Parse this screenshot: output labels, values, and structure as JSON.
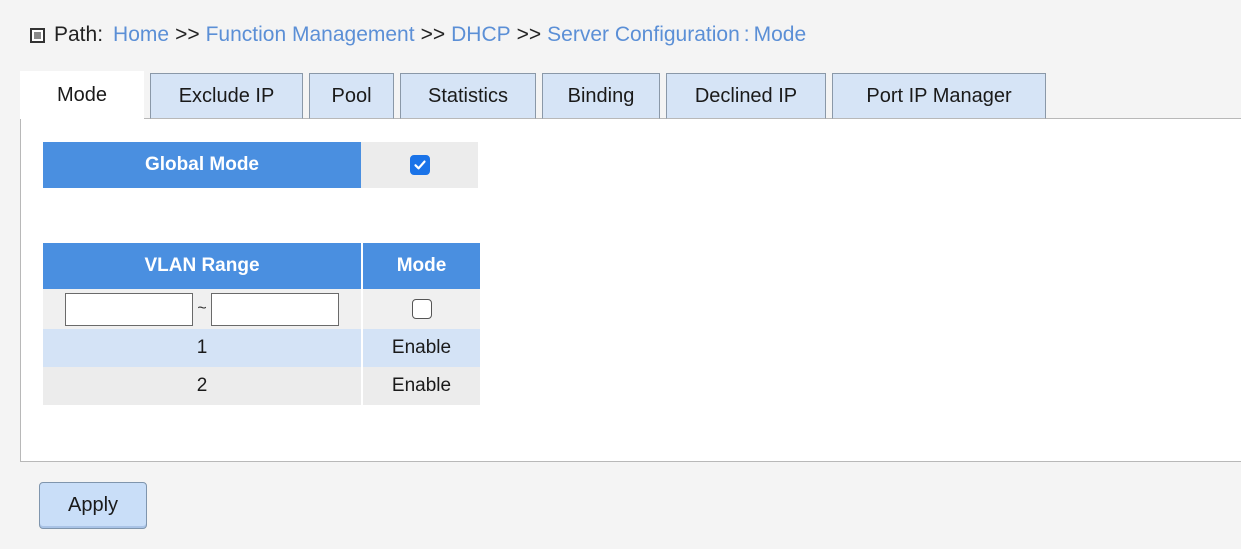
{
  "breadcrumb": {
    "prefix": "Path:",
    "items": [
      "Home",
      "Function Management",
      "DHCP",
      "Server Configuration"
    ],
    "separator": ">>",
    "current": "Mode",
    "current_separator": ":"
  },
  "tabs": [
    {
      "label": "Mode",
      "active": true
    },
    {
      "label": "Exclude IP",
      "active": false
    },
    {
      "label": "Pool",
      "active": false
    },
    {
      "label": "Statistics",
      "active": false
    },
    {
      "label": "Binding",
      "active": false
    },
    {
      "label": "Declined IP",
      "active": false
    },
    {
      "label": "Port IP Manager",
      "active": false
    }
  ],
  "global": {
    "label": "Global Mode",
    "checked": true
  },
  "vlan_table": {
    "headers": [
      "VLAN Range",
      "Mode"
    ],
    "range_from": "",
    "range_separator": "~",
    "range_to": "",
    "mode_checked": false,
    "rows": [
      {
        "vlan": "1",
        "mode": "Enable"
      },
      {
        "vlan": "2",
        "mode": "Enable"
      }
    ]
  },
  "apply_label": "Apply",
  "colors": {
    "header_blue": "#4a8fe0",
    "link_blue": "#5b8fd6",
    "checkbox_blue": "#1a73e8",
    "row_blue": "#d4e3f6",
    "row_grey": "#ececec"
  }
}
